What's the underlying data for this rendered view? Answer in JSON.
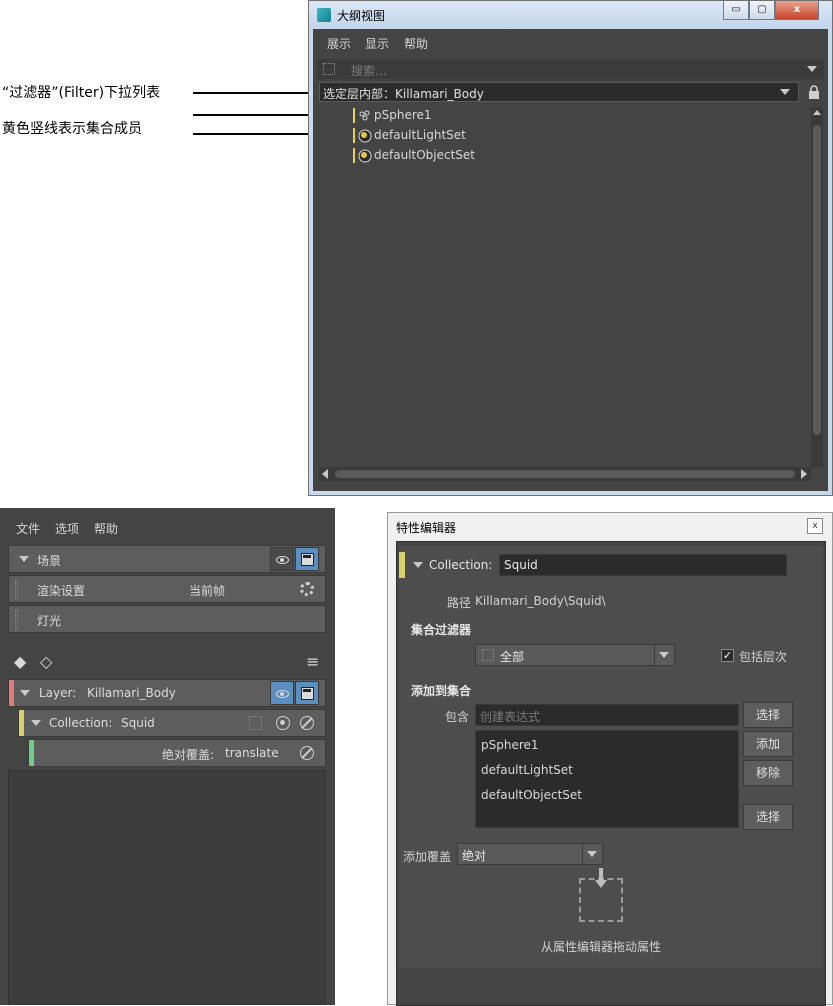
{
  "annotations": {
    "filter_dropdown": "“过滤器”(Filter)下拉列表",
    "yellow_bar": "黄色竖线表示集合成员"
  },
  "outliner": {
    "title": "大纲视图",
    "window_buttons": {
      "minimize": "▭",
      "maximize": "▢",
      "close": "x"
    },
    "menu": [
      "展示",
      "显示",
      "帮助"
    ],
    "search_placeholder": "搜索...",
    "filter_value": "选定层内部：Killamari_Body",
    "items": [
      "pSphere1",
      "defaultLightSet",
      "defaultObjectSet"
    ]
  },
  "render_setup": {
    "menu": [
      "文件",
      "选项",
      "帮助"
    ],
    "scene_label": "场景",
    "render_settings_label": "渲染设置",
    "render_settings_value": "当前帧",
    "lights_label": "灯光",
    "layer_label": "Layer:",
    "layer_name": "Killamari_Body",
    "collection_label": "Collection:",
    "collection_name": "Squid",
    "override_label": "绝对覆盖:",
    "override_value": "translate",
    "colors": {
      "layer_tag": "#e07a7a",
      "collection_tag": "#d6cf6a",
      "override_tag": "#6fcf87",
      "toggle_blue": "#5b8fc0"
    }
  },
  "attribute_editor": {
    "title": "特性编辑器",
    "close_label": "x",
    "collection_label": "Collection:",
    "collection_name": "Squid",
    "path_label": "路径",
    "path_value": "Killamari_Body\\Squid\\",
    "filter_section": "集合过滤器",
    "filter_value": "全部",
    "include_hierarchy_label": "包括层次",
    "include_hierarchy_checked": true,
    "add_to_collection_section": "添加到集合",
    "include_label": "包含",
    "expression_placeholder": "创建表达式",
    "select_button": "选择",
    "add_button": "添加",
    "remove_button": "移除",
    "select_button_2": "选择",
    "members": [
      "pSphere1",
      "defaultLightSet",
      "defaultObjectSet"
    ],
    "add_override_label": "添加覆盖",
    "override_value": "绝对",
    "drop_hint": "从属性编辑器拖动属性"
  }
}
